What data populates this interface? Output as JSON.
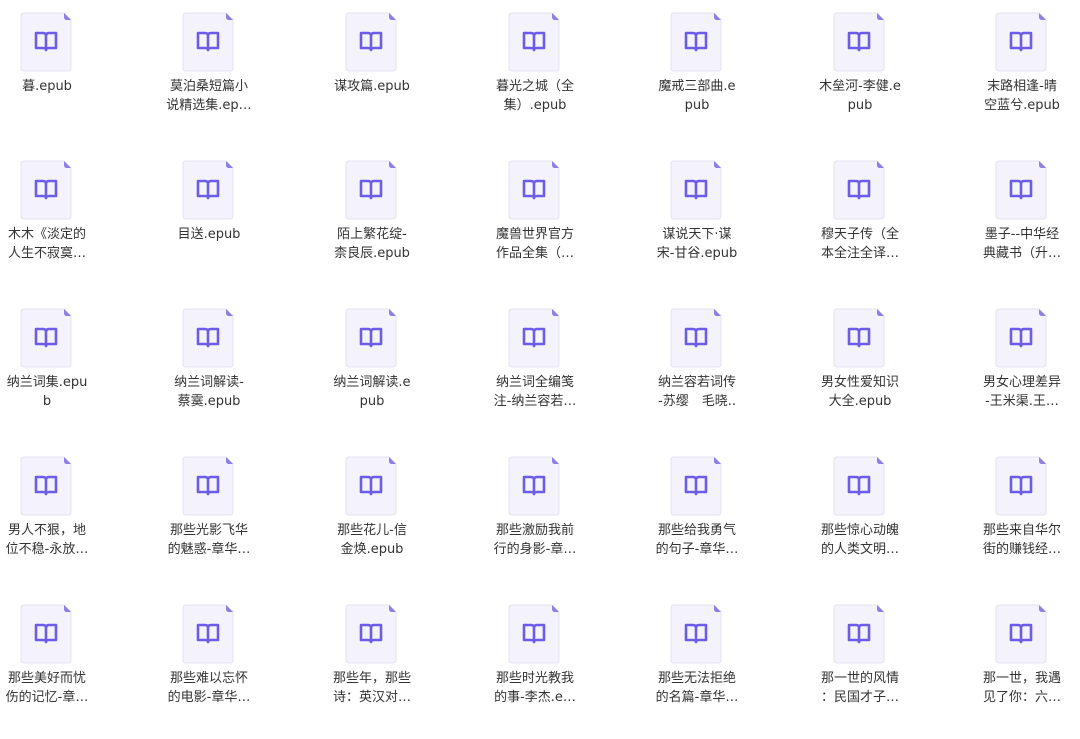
{
  "colors": {
    "page_bg": "#ffffff",
    "doc_fill": "#f4f3fb",
    "doc_edge": "#e3e1f2",
    "fold": "#8b7fe6",
    "book_stroke": "#6c5ce7",
    "label_text": "#333333"
  },
  "icon": "epub-book-document-icon",
  "files": [
    {
      "label": "暮.epub"
    },
    {
      "label": "莫泊桑短篇小\n说精选集.ep…"
    },
    {
      "label": "谋攻篇.epub"
    },
    {
      "label": "暮光之城（全\n集）.epub"
    },
    {
      "label": "魔戒三部曲.e\npub"
    },
    {
      "label": "木垒河-李健.e\npub"
    },
    {
      "label": "末路相逢-晴\n空蓝兮.epub"
    },
    {
      "label": "木木《淡定的\n人生不寂寞…"
    },
    {
      "label": "目送.epub"
    },
    {
      "label": "陌上繁花绽-\n柰良辰.epub"
    },
    {
      "label": "魔兽世界官方\n作品全集（…"
    },
    {
      "label": "谋说天下·谋\n宋-甘谷.epub"
    },
    {
      "label": "穆天子传（全\n本全注全译…"
    },
    {
      "label": "墨子--中华经\n典藏书（升…"
    },
    {
      "label": "纳兰词集.epu\nb"
    },
    {
      "label": "纳兰词解读-\n蔡霙.epub"
    },
    {
      "label": "纳兰词解读.e\npub"
    },
    {
      "label": "纳兰词全编笺\n注-纳兰容若…"
    },
    {
      "label": "纳兰容若词传\n-苏缨　毛晓.."
    },
    {
      "label": "男女性爱知识\n大全.epub"
    },
    {
      "label": "男女心理差异\n-王米渠.王…"
    },
    {
      "label": "男人不狠，地\n位不稳-永放…"
    },
    {
      "label": "那些光影飞华\n的魅惑-章华…"
    },
    {
      "label": "那些花儿-信\n金焕.epub"
    },
    {
      "label": "那些激励我前\n行的身影-章…"
    },
    {
      "label": "那些给我勇气\n的句子-章华…"
    },
    {
      "label": "那些惊心动魄\n的人类文明…"
    },
    {
      "label": "那些来自华尔\n街的赚钱经…"
    },
    {
      "label": "那些美好而忧\n伤的记忆-章…"
    },
    {
      "label": "那些难以忘怀\n的电影-章华…"
    },
    {
      "label": "那些年，那些\n诗：英汉对…"
    },
    {
      "label": "那些时光教我\n的事-李杰.e…"
    },
    {
      "label": "那些无法拒绝\n的名篇-章华…"
    },
    {
      "label": "那一世的风情\n：民国才子…"
    },
    {
      "label": "那一世，我遇\n见了你：六…"
    }
  ]
}
